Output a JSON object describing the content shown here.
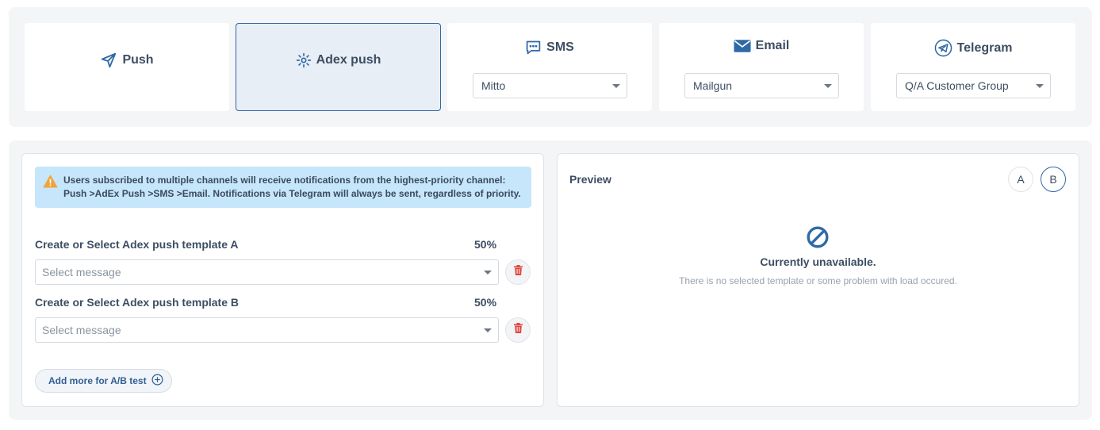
{
  "channels": {
    "push": {
      "label": "Push",
      "icon": "send-icon"
    },
    "adex": {
      "label": "Adex push",
      "icon": "sparkle-icon"
    },
    "sms": {
      "label": "SMS",
      "icon": "chat-icon",
      "selected": "Mitto"
    },
    "email": {
      "label": "Email",
      "icon": "envelope-icon",
      "selected": "Mailgun"
    },
    "telegram": {
      "label": "Telegram",
      "icon": "telegram-icon",
      "selected": "Q/A Customer Group"
    }
  },
  "info": {
    "text": "Users subscribed to multiple channels will receive notifications from the highest-priority channel: Push >AdEx Push >SMS >Email. Notifications via Telegram will always be sent, regardless of priority."
  },
  "templates": [
    {
      "label": "Create or Select Adex push template A",
      "percent": "50%",
      "placeholder": "Select message"
    },
    {
      "label": "Create or Select Adex push template B",
      "percent": "50%",
      "placeholder": "Select message"
    }
  ],
  "ab_button": {
    "label": "Add more for A/B test"
  },
  "preview": {
    "title": "Preview",
    "variant_a": "A",
    "variant_b": "B",
    "unavailable_title": "Currently unavailable.",
    "unavailable_sub": "There is no selected template or some problem with load occured."
  },
  "colors": {
    "accent": "#2f6aa6",
    "info_bg": "#c6e6fb",
    "warning": "#f0a33a",
    "delete": "#e2453c"
  }
}
